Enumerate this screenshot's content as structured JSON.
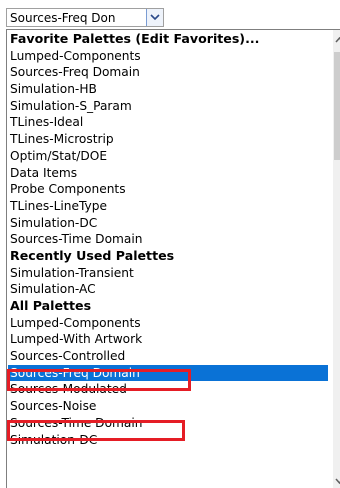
{
  "combo": {
    "value": "Sources-Freq Don",
    "dropdown_icon": "chevron-down-icon"
  },
  "sections": [
    {
      "header": "Favorite Palettes (Edit Favorites)...",
      "items": [
        "Lumped-Components",
        "Sources-Freq Domain",
        "Simulation-HB",
        "Simulation-S_Param",
        "TLines-Ideal",
        "TLines-Microstrip",
        "Optim/Stat/DOE",
        "Data Items",
        "Probe Components",
        "TLines-LineType",
        "Simulation-DC",
        "Sources-Time Domain"
      ]
    },
    {
      "header": "Recently Used Palettes",
      "items": [
        "Simulation-Transient",
        "Simulation-AC"
      ]
    },
    {
      "header": "All Palettes",
      "items": [
        "Lumped-Components",
        "Lumped-With Artwork",
        "Sources-Controlled",
        "Sources-Freq Domain",
        "Sources-Modulated",
        "Sources-Noise",
        "Sources-Time Domain",
        "Simulation-DC"
      ]
    }
  ],
  "selected_item": "Sources-Freq Domain",
  "colors": {
    "selection": "#0a72d6",
    "annotation": "#e51d25"
  },
  "scrollbar": {
    "up_icon": "scroll-up-arrow-icon",
    "down_icon": "scroll-down-arrow-icon"
  }
}
